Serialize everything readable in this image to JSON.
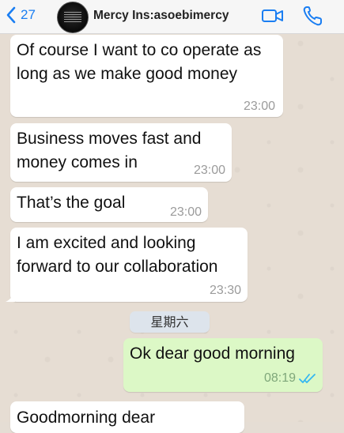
{
  "header": {
    "back_count": "27",
    "contact_name": "Mercy Ins:asoebimercy",
    "icons": {
      "back": "chevron-left-icon",
      "video": "video-camera-icon",
      "call": "phone-icon"
    },
    "accent_color": "#1a7ef2"
  },
  "messages": [
    {
      "direction": "in",
      "text": "Of course I want to co operate as long as we make good money",
      "time": "23:00"
    },
    {
      "direction": "in",
      "text": "Business moves fast and money comes in",
      "time": "23:00"
    },
    {
      "direction": "in",
      "text": "That’s the goal",
      "time": "23:00"
    },
    {
      "direction": "in",
      "text": "I am excited and looking forward to our collaboration",
      "time": "23:30"
    },
    {
      "direction": "out",
      "text": "Ok dear good morning",
      "time": "08:19",
      "status": "read"
    },
    {
      "direction": "in",
      "text": "Goodmorning dear",
      "time": ""
    }
  ],
  "date_separator": "星期六",
  "colors": {
    "incoming_bubble": "#ffffff",
    "outgoing_bubble": "#dcf8c6",
    "read_ticks": "#34b7f1"
  }
}
